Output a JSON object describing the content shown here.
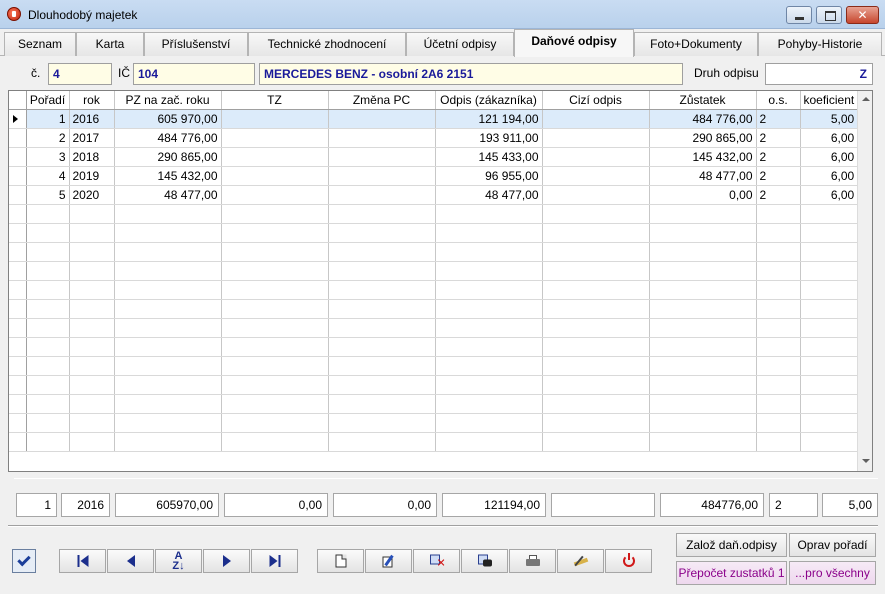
{
  "window": {
    "title": "Dlouhodobý majetek"
  },
  "tabs": [
    {
      "label": "Seznam"
    },
    {
      "label": "Karta"
    },
    {
      "label": "Příslušenství"
    },
    {
      "label": "Technické zhodnocení"
    },
    {
      "label": "Účetní odpisy"
    },
    {
      "label": "Daňové odpisy"
    },
    {
      "label": "Foto+Dokumenty"
    },
    {
      "label": "Pohyby-Historie"
    }
  ],
  "header": {
    "cislo_label": "č.",
    "cislo_value": "4",
    "ic_label": "IČ",
    "ic_value": "104",
    "name_value": "MERCEDES BENZ - osobní 2A6 2151",
    "druh_label": "Druh odpisu",
    "druh_value": "Z"
  },
  "grid": {
    "columns": [
      "Pořadí",
      "rok",
      "PZ na zač. roku",
      "TZ",
      "Změna PC",
      "Odpis (zákazníka)",
      "Cizí odpis",
      "Zůstatek",
      "o.s.",
      "koeficient"
    ],
    "rows": [
      [
        "1",
        "2016",
        "605 970,00",
        "",
        "",
        "121 194,00",
        "",
        "484 776,00",
        "2",
        "5,00"
      ],
      [
        "2",
        "2017",
        "484 776,00",
        "",
        "",
        "193 911,00",
        "",
        "290 865,00",
        "2",
        "6,00"
      ],
      [
        "3",
        "2018",
        "290 865,00",
        "",
        "",
        "145 433,00",
        "",
        "145 432,00",
        "2",
        "6,00"
      ],
      [
        "4",
        "2019",
        "145 432,00",
        "",
        "",
        "96 955,00",
        "",
        "48 477,00",
        "2",
        "6,00"
      ],
      [
        "5",
        "2020",
        "48 477,00",
        "",
        "",
        "48 477,00",
        "",
        "0,00",
        "2",
        "6,00"
      ]
    ]
  },
  "summary": [
    "1",
    "2016",
    "605970,00",
    "0,00",
    "0,00",
    "121194,00",
    "",
    "484776,00",
    "2",
    "5,00"
  ],
  "actions": {
    "zaloz": "Založ daň.odpisy",
    "oprav": "Oprav pořadí",
    "prepocet": "Přepočet zustatků 1",
    "pro_vsechny": "...pro všechny"
  },
  "icons": {
    "app": "app-icon",
    "confirm": "check-icon",
    "first": "first-record-icon",
    "prev": "previous-record-icon",
    "sort": "sort-icon",
    "next": "next-record-icon",
    "last": "last-record-icon",
    "new": "new-document-icon",
    "edit": "edit-icon",
    "delete": "delete-icon",
    "find": "find-icon",
    "print": "printer-icon",
    "tools": "tools-icon",
    "close": "power-icon"
  },
  "colors": {
    "highlight_field": "#fffde6",
    "field_text": "#1a1a9a",
    "selected_row": "#dcebfa",
    "purple_button_text": "#8a008a"
  }
}
